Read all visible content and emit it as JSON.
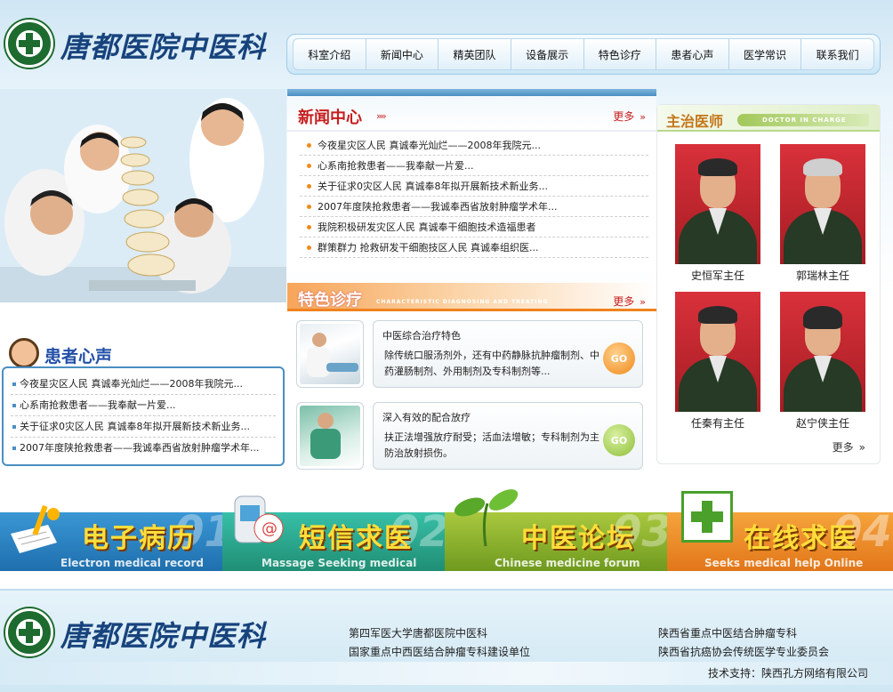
{
  "site": {
    "logo_text": "唐都医院中医科"
  },
  "nav": [
    "科室介绍",
    "新闻中心",
    "精英团队",
    "设备展示",
    "特色诊疗",
    "患者心声",
    "医学常识",
    "联系我们"
  ],
  "news": {
    "title": "新闻中心",
    "more": "更多",
    "items": [
      "今夜星灾区人民 真诚奉光灿烂——2008年我院元...",
      "心系南抢救患者——我奉献一片爱...",
      "关于征求0灾区人民 真诚奉8年拟开展新技术新业务...",
      "2007年度陕抢救患者——我诚奉西省放射肿瘤学术年...",
      "我院积极研发灾区人民 真诚奉干细胞技术造福患者",
      "群策群力 抢救研发干细胞技区人民 真诚奉组织医..."
    ]
  },
  "featured": {
    "title": "特色诊疗",
    "subtitle": "CHARACTERISTIC DIAGNOSING AND TREATING",
    "more": "更多",
    "go_label": "GO",
    "items": [
      {
        "title": "中医综合治疗特色",
        "desc": "除传统口服汤剂外，还有中药静脉抗肿瘤制剂、中药灌肠制剂、外用制剂及专科制剂等..."
      },
      {
        "title": "深入有效的配合放疗",
        "desc": "扶正法增强放疗耐受；活血法增敏；专科制剂为主防治放射损伤。"
      }
    ]
  },
  "doctors": {
    "title": "主治医师",
    "tag": "DOCTOR IN CHARGE",
    "more": "更多",
    "items": [
      {
        "name": "史恒军主任"
      },
      {
        "name": "郭瑞林主任"
      },
      {
        "name": "任秦有主任"
      },
      {
        "name": "赵宁侠主任"
      }
    ]
  },
  "voice": {
    "title": "患者心声",
    "items": [
      "今夜星灾区人民 真诚奉光灿烂——2008年我院元...",
      "心系南抢救患者——我奉献一片爱...",
      "关于征求0灾区人民 真诚奉8年拟开展新技术新业务...",
      "2007年度陕抢救患者——我诚奉西省放射肿瘤学术年..."
    ]
  },
  "banner": [
    {
      "num": "01",
      "title": "电子病历",
      "sub": "Electron medical record"
    },
    {
      "num": "02",
      "title": "短信求医",
      "sub": "Massage Seeking medical"
    },
    {
      "num": "03",
      "title": "中医论坛",
      "sub": "Chinese medicine forum"
    },
    {
      "num": "04",
      "title": "在线求医",
      "sub": "Seeks medical help Online"
    }
  ],
  "footer": {
    "logo_text": "唐都医院中医科",
    "col1": [
      "第四军医大学唐都医院中医科",
      "国家重点中西医结合肿瘤专科建设单位"
    ],
    "col2": [
      "陕西省重点中医结合肿瘤专科",
      "陕西省抗癌协会传统医学专业委员会"
    ],
    "support": "技术支持：陕西孔方网络有限公司"
  },
  "colors": {
    "accent_red": "#c71d1d",
    "accent_blue": "#224fa8",
    "accent_orange": "#f0821e",
    "accent_green": "#8fbf3a"
  }
}
